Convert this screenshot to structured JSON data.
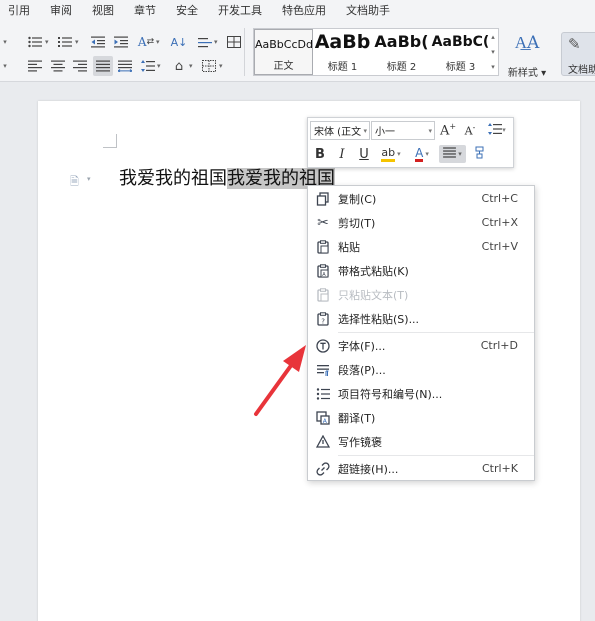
{
  "menu": {
    "items": [
      "引用",
      "审阅",
      "视图",
      "章节",
      "安全",
      "开发工具",
      "特色应用",
      "文档助手"
    ]
  },
  "ribbon": {
    "styles": [
      {
        "preview": "AaBbCcDd",
        "name": "正文",
        "selected": true
      },
      {
        "preview": "AaBb",
        "name": "标题 1",
        "selected": false
      },
      {
        "preview": "AaBb(",
        "name": "标题 2",
        "selected": false
      },
      {
        "preview": "AaBbC(",
        "name": "标题 3",
        "selected": false
      }
    ],
    "new_style_label": "新样式",
    "new_style_icon": "new-style-icon",
    "doc_assist_label": "文档助",
    "icon_color": "#3b6fb6"
  },
  "document": {
    "text_plain": "我爱我的祖国",
    "text_selected": "我爱我的祖国",
    "selection_color": "#c6c6c6"
  },
  "mini_toolbar": {
    "font_name": "宋体 (正文",
    "font_size": "小一",
    "buttons": [
      "bold",
      "italic",
      "underline",
      "highlight",
      "font-color",
      "align",
      "format-painter",
      "grow-font",
      "shrink-font",
      "line-spacing"
    ],
    "bold": "B",
    "italic": "I",
    "underline": "U",
    "highlight": "ab",
    "font_color": "A",
    "grow": "A",
    "shrink": "A",
    "highlight_color": "#f5c400",
    "font_color_value": "#d32020"
  },
  "context_menu": {
    "items": [
      {
        "label": "复制(C)",
        "shortcut": "Ctrl+C",
        "icon": "copy-icon",
        "disabled": false
      },
      {
        "label": "剪切(T)",
        "shortcut": "Ctrl+X",
        "icon": "scissors-icon",
        "disabled": false
      },
      {
        "label": "粘贴",
        "shortcut": "Ctrl+V",
        "icon": "paste-icon",
        "disabled": false
      },
      {
        "label": "带格式粘贴(K)",
        "shortcut": "",
        "icon": "paste-format-icon",
        "disabled": false
      },
      {
        "label": "只粘贴文本(T)",
        "shortcut": "",
        "icon": "paste-text-icon",
        "disabled": true
      },
      {
        "label": "选择性粘贴(S)...",
        "shortcut": "",
        "icon": "paste-special-icon",
        "disabled": false
      },
      {
        "label": "字体(F)...",
        "shortcut": "Ctrl+D",
        "icon": "font-icon",
        "disabled": false
      },
      {
        "label": "段落(P)...",
        "shortcut": "",
        "icon": "paragraph-icon",
        "disabled": false
      },
      {
        "label": "项目符号和编号(N)...",
        "shortcut": "",
        "icon": "bullets-icon",
        "disabled": false
      },
      {
        "label": "翻译(T)",
        "shortcut": "",
        "icon": "translate-icon",
        "disabled": false
      },
      {
        "label": "写作镜褒",
        "shortcut": "",
        "icon": "writing-icon",
        "disabled": false
      },
      {
        "label": "超链接(H)...",
        "shortcut": "Ctrl+K",
        "icon": "link-icon",
        "disabled": false
      }
    ]
  },
  "annotation": {
    "arrow_color": "#e8343a"
  }
}
